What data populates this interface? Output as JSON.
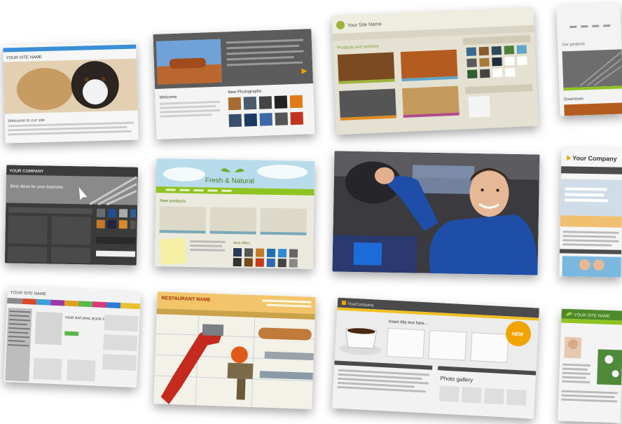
{
  "gallery": {
    "tiles": [
      {
        "name": "pets-template",
        "header": "YOUR SITE NAME",
        "caption": "Welcome to our site"
      },
      {
        "name": "outback-template",
        "header": "",
        "caption": "Welcome",
        "side": "New Photographs"
      },
      {
        "name": "olive-template",
        "header": "Your Site Name",
        "caption": "Products and services"
      },
      {
        "name": "grey-template-right",
        "header": "",
        "caption": "Our projects",
        "sub": "Downtown"
      },
      {
        "name": "dark-template",
        "header": "YOUR COMPANY",
        "caption": "Best ideas for your business"
      },
      {
        "name": "fresh-natural-template",
        "header": "Fresh & Natural",
        "caption": "New products",
        "sub": "Best offers"
      },
      {
        "name": "mechanic-photo",
        "header": "",
        "caption": ""
      },
      {
        "name": "company-template-right",
        "header": "Your Company",
        "caption": ""
      },
      {
        "name": "book-template",
        "header": "YOUR SITE NAME",
        "caption": "HOW NATURAL BOOK PUBLISHING"
      },
      {
        "name": "restaurant-template",
        "header": "RESTAURANT NAME",
        "caption": ""
      },
      {
        "name": "coffee-template",
        "header": "YourCompany",
        "caption": "Insert title text here...",
        "sub": "Photo gallery",
        "badge": "NEW"
      },
      {
        "name": "green-template-right",
        "header": "YOUR SITE NAME",
        "caption": ""
      }
    ]
  },
  "colors": {
    "accent_orange": "#f0a400",
    "accent_green": "#8fc321",
    "dark_panel": "#3d3d3d",
    "worker_blue": "#1f4ea8"
  }
}
